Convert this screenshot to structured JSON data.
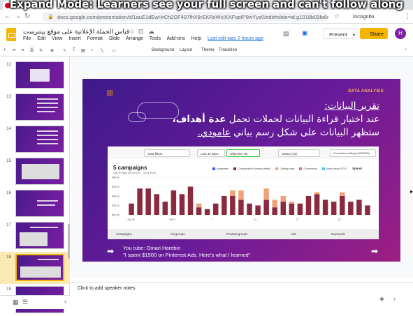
{
  "banner": "Expand Mode: Learners see your full screen and can't follow along",
  "browser": {
    "tab_title": "Pinter",
    "url": "docs.google.com/presentation/d/1auE1dEwHrCh2OF497fhX6rEKRsWc(KAFqeIP9wYyz0/edit#slide=id.g1018b03fa8e_1_478",
    "incognito": "Incognito"
  },
  "app": {
    "doc_title": "قياس الحملة الإعلانية على موقع بينترست",
    "menus": [
      "File",
      "Edit",
      "View",
      "Insert",
      "Format",
      "Slide",
      "Arrange",
      "Tools",
      "Add-ons",
      "Help"
    ],
    "last_edit": "Last edit was 2 hours ago",
    "present_label": "Present",
    "share_label": "Share",
    "avatar": "H"
  },
  "toolbar": {
    "background": "Background",
    "layout": "Layout",
    "theme": "Theme",
    "transition": "Transition"
  },
  "thumbnails": [
    {
      "num": "12"
    },
    {
      "num": "13"
    },
    {
      "num": "14"
    },
    {
      "num": "15"
    },
    {
      "num": "16"
    },
    {
      "num": "17"
    },
    {
      "num": "18"
    },
    {
      "num": "19"
    }
  ],
  "slide": {
    "label": "DATA ANALYSIS",
    "heading": "تقرير البيانات:",
    "line1_pre": "عند اختيار قراءة البيانات لحملات تحمل ",
    "line1_bold": "عدة أهداف،",
    "line2_pre": "ستظهر البيانات على شكل رسم بياني ",
    "line2_u": "عامودي.",
    "youtube_line1": "You tube: Omari Harebin",
    "youtube_line2": "\"I spent $1500 on Pinterest Ads. Here's what I learned\""
  },
  "embedded": {
    "filters": [
      "Data filters",
      "Last 30 days",
      "Objective (5)",
      "Status (12)",
      "Conversion settings (30/30/30)"
    ],
    "campaigns_title": "5 campaigns",
    "campaigns_sub": "Last 30 days (01/26/2021 - 02/24/2021)",
    "legend": [
      "Awareness",
      "Consideration (formerly traffic)",
      "Catalog sales",
      "Conversions",
      "Video views (CPV)"
    ],
    "spend_label": "Spend",
    "tabs": [
      "Campaigns",
      "Ad groups",
      "Product groups",
      "Ads",
      "Keywords"
    ]
  },
  "chart_data": {
    "type": "bar",
    "title": "5 campaigns",
    "ylabel": "Spend",
    "y_ticks": [
      "$48.00",
      "$44.00",
      "$40.00",
      "$36.00",
      "$32.00"
    ],
    "x_ticks": [
      "Jan 28",
      "Feb 2",
      "7",
      "12",
      "17",
      "22"
    ],
    "series": [
      {
        "name": "Conversions",
        "color": "#8b2a3f",
        "values": [
          36,
          44,
          44,
          41,
          37,
          43,
          41,
          45,
          34,
          33,
          36,
          40,
          40,
          38,
          36,
          35,
          38,
          34,
          37,
          36,
          36,
          40,
          41,
          38,
          37,
          40,
          37,
          38,
          35
        ]
      },
      {
        "name": "Catalog sales",
        "color": "#f0a37a",
        "values": [
          0,
          0,
          0,
          0,
          0,
          0,
          0,
          0,
          2,
          0,
          0,
          0,
          3,
          5,
          0,
          0,
          6,
          4,
          3,
          1,
          0,
          0,
          1,
          0,
          0,
          2,
          0,
          0,
          0
        ]
      }
    ],
    "ylim": [
      30,
      50
    ]
  },
  "notes_placeholder": "Click to add speaker notes"
}
